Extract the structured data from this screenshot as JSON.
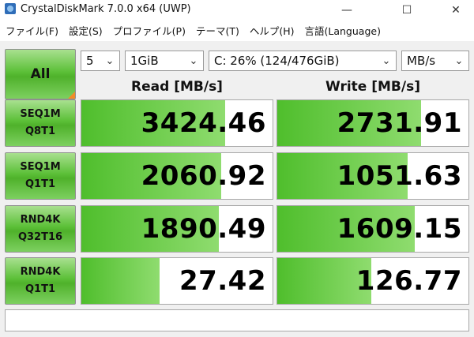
{
  "window": {
    "title": "CrystalDiskMark 7.0.0 x64 (UWP)",
    "minimize_glyph": "—",
    "maximize_glyph": "☐",
    "close_glyph": "✕"
  },
  "menu": [
    "ファイル(F)",
    "設定(S)",
    "プロファイル(P)",
    "テーマ(T)",
    "ヘルプ(H)",
    "言語(Language)"
  ],
  "toolbar": {
    "all_label": "All",
    "count": "5",
    "size": "1GiB",
    "drive": "C: 26% (124/476GiB)",
    "unit": "MB/s"
  },
  "headers": {
    "read": "Read [MB/s]",
    "write": "Write [MB/s]"
  },
  "tests": [
    {
      "line1": "SEQ1M",
      "line2": "Q8T1",
      "read": "3424.46",
      "write": "2731.91",
      "read_fill": 0.75,
      "write_fill": 0.75
    },
    {
      "line1": "SEQ1M",
      "line2": "Q1T1",
      "read": "2060.92",
      "write": "1051.63",
      "read_fill": 0.73,
      "write_fill": 0.68
    },
    {
      "line1": "RND4K",
      "line2": "Q32T16",
      "read": "1890.49",
      "write": "1609.15",
      "read_fill": 0.72,
      "write_fill": 0.72
    },
    {
      "line1": "RND4K",
      "line2": "Q1T1",
      "read": "27.42",
      "write": "126.77",
      "read_fill": 0.41,
      "write_fill": 0.49
    }
  ],
  "colors": {
    "green": "#4fb12b",
    "accent_orange": "#f28c28"
  },
  "icons": {
    "app": "crystaldiskmark-app-icon"
  }
}
